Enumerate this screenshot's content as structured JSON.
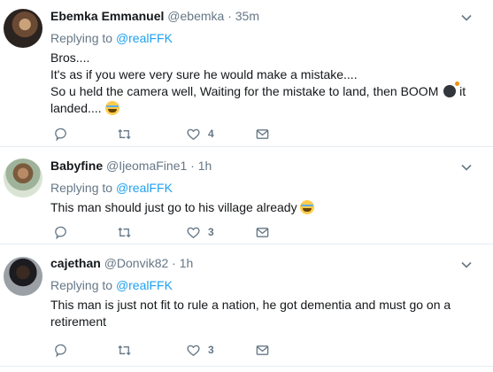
{
  "tweets": [
    {
      "name": "Ebemka Emmanuel",
      "handle": "@ebemka",
      "dot": "·",
      "time": "35m",
      "replying_prefix": "Replying to ",
      "replying_to": "@realFFK",
      "lines": [
        "Bros....",
        "It's as if you were very sure he would make a mistake....",
        "So u held the camera well, Waiting for the mistake to land, then BOOM",
        "it",
        "landed...."
      ],
      "likes": "4"
    },
    {
      "name": "Babyfine",
      "handle": "@IjeomaFine1",
      "dot": "·",
      "time": "1h",
      "replying_prefix": "Replying to ",
      "replying_to": "@realFFK",
      "lines": [
        "This man should just go to his village already"
      ],
      "likes": "3"
    },
    {
      "name": "cajethan",
      "handle": "@Donvik82",
      "dot": "·",
      "time": "1h",
      "replying_prefix": "Replying to ",
      "replying_to": "@realFFK",
      "lines": [
        "This man is just not fit to rule a nation, he got dementia and must go on a",
        "retirement"
      ],
      "likes": "3"
    }
  ],
  "icons": {
    "reply": "reply-icon",
    "retweet": "retweet-icon",
    "like": "heart-icon",
    "dm": "envelope-icon",
    "caret": "chevron-down-icon"
  },
  "colors": {
    "link": "#1da1f2",
    "meta": "#657786",
    "text": "#14171a",
    "divider": "#e6ecf0"
  }
}
